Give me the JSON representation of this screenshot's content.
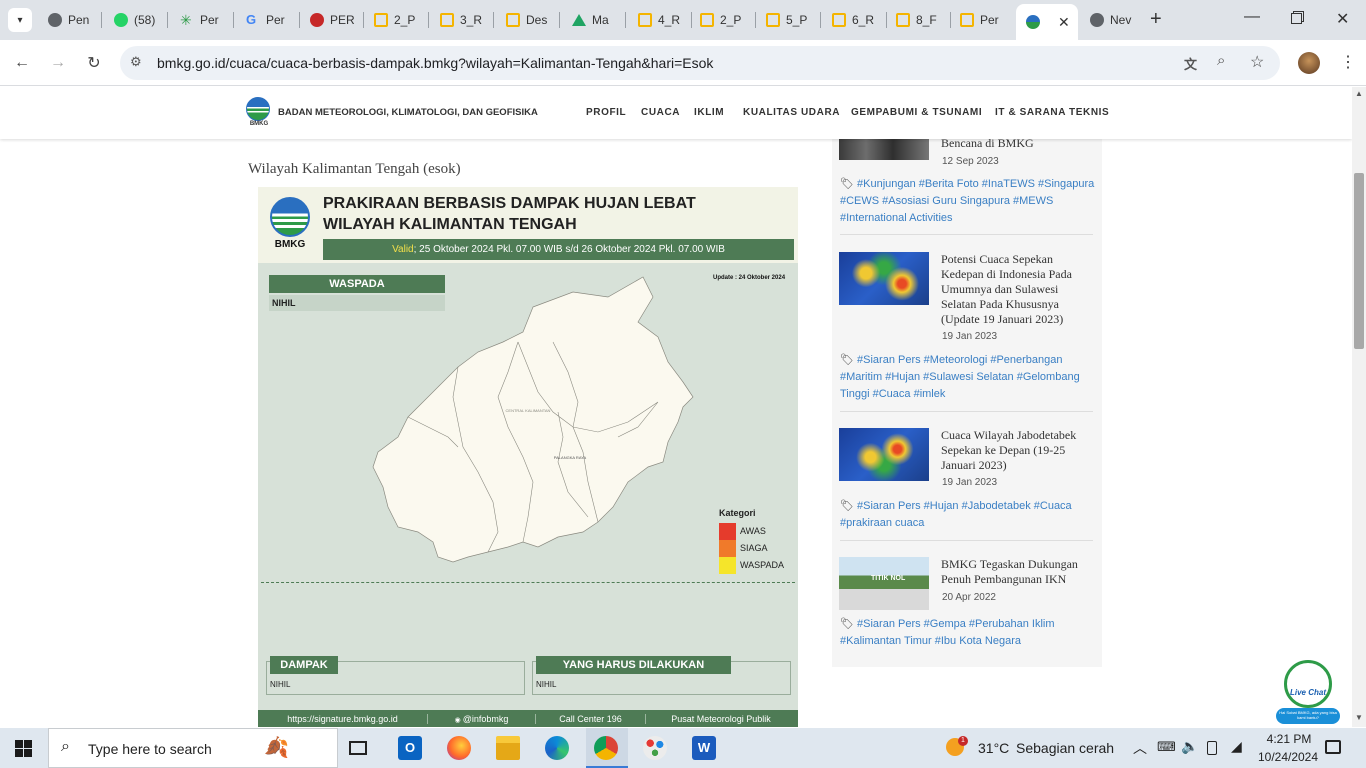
{
  "browser": {
    "tabs": [
      {
        "label": "Pen",
        "icon": "globe-icon"
      },
      {
        "label": "(58)",
        "icon": "whatsapp-icon"
      },
      {
        "label": "Per",
        "icon": "leaf-icon"
      },
      {
        "label": "Per",
        "icon": "google-icon"
      },
      {
        "label": "PER",
        "icon": "warning-icon"
      },
      {
        "label": "2_P",
        "icon": "slides-icon"
      },
      {
        "label": "3_R",
        "icon": "slides-icon"
      },
      {
        "label": "Des",
        "icon": "slides-icon"
      },
      {
        "label": "Ma",
        "icon": "drive-icon"
      },
      {
        "label": "4_R",
        "icon": "slides-icon"
      },
      {
        "label": "2_P",
        "icon": "slides-icon"
      },
      {
        "label": "5_P",
        "icon": "slides-icon"
      },
      {
        "label": "6_R",
        "icon": "slides-icon"
      },
      {
        "label": "8_F",
        "icon": "slides-icon"
      },
      {
        "label": "Per",
        "icon": "slides-icon"
      },
      {
        "label": "",
        "icon": "bmkg-icon"
      },
      {
        "label": "Nev",
        "icon": "globe-icon"
      }
    ],
    "url": "bmkg.go.id/cuaca/cuaca-berbasis-dampak.bmkg?wilayah=Kalimantan-Tengah&hari=Esok"
  },
  "site": {
    "org_name": "BADAN METEOROLOGI, KLIMATOLOGI, DAN GEOFISIKA",
    "logo_text": "BMKG",
    "nav": [
      "PROFIL",
      "CUACA",
      "IKLIM",
      "KUALITAS UDARA",
      "GEMPABUMI & TSUNAMI",
      "IT & SARANA TEKNIS"
    ]
  },
  "main": {
    "region_heading": "Wilayah Kalimantan Tengah (esok)",
    "infographic": {
      "logo_text": "BMKG",
      "title_line1": "PRAKIRAAN BERBASIS DAMPAK HUJAN LEBAT",
      "title_line2": "WILAYAH KALIMANTAN TENGAH",
      "valid_label": "Valid",
      "valid_text": "; 25 Oktober 2024 Pkl. 07.00 WIB s/d 26 Oktober 2024 Pkl. 07.00 WIB",
      "waspada_label": "WASPADA",
      "waspada_value": "NIHIL",
      "update_text": "Update : 24 Oktober 2024",
      "map_label_central": "CENTRAL KALIMANTAN",
      "map_label_city": "PALANGKA RAYA",
      "legend_title": "Kategori",
      "legend": [
        {
          "label": "AWAS",
          "color": "#e53b2c"
        },
        {
          "label": "SIAGA",
          "color": "#f07a2a"
        },
        {
          "label": "WASPADA",
          "color": "#f5e52a"
        }
      ],
      "dampak_label": "DAMPAK",
      "dampak_value": "NIHIL",
      "harus_label": "YANG HARUS DILAKUKAN",
      "harus_value": "NIHIL",
      "footer": [
        "https://signature.bmkg.go.id",
        "@infobmkg",
        "Call Center 196",
        "Pusat Meteorologi Publik"
      ]
    }
  },
  "sidebar": {
    "items": [
      {
        "title": "Bencana di BMKG",
        "date": "12 Sep 2023",
        "tags": "#Kunjungan #Berita Foto #InaTEWS #Singapura #CEWS #Asosiasi Guru Singapura #MEWS #International Activities"
      },
      {
        "title": "Potensi Cuaca Sepekan Kedepan di Indonesia Pada Umumnya dan Sulawesi Selatan Pada Khususnya (Update 19 Januari 2023)",
        "date": "19 Jan 2023",
        "tags": "#Siaran Pers #Meteorologi #Penerbangan #Maritim #Hujan #Sulawesi Selatan #Gelombang Tinggi #Cuaca #imlek"
      },
      {
        "title": "Cuaca Wilayah Jabodetabek Sepekan ke Depan (19-25 Januari 2023)",
        "date": "19 Jan 2023",
        "tags": "#Siaran Pers #Hujan #Jabodetabek #Cuaca #prakiraan cuaca"
      },
      {
        "title": "BMKG Tegaskan Dukungan Penuh Pembangunan IKN",
        "date": "20 Apr 2022",
        "tags": "#Siaran Pers #Gempa #Perubahan Iklim #Kalimantan Timur #Ibu Kota Negara"
      }
    ],
    "thumb4_text": "TITIK NOL"
  },
  "livechat": {
    "label": "Live Chat",
    "sub": "Hai Sobat BMKG, ada yang bisa kami bantu?"
  },
  "taskbar": {
    "search_placeholder": "Type here to search",
    "weather_temp": "31°C",
    "weather_desc": "Sebagian cerah",
    "weather_badge": "1",
    "time": "4:21 PM",
    "date": "10/24/2024"
  }
}
